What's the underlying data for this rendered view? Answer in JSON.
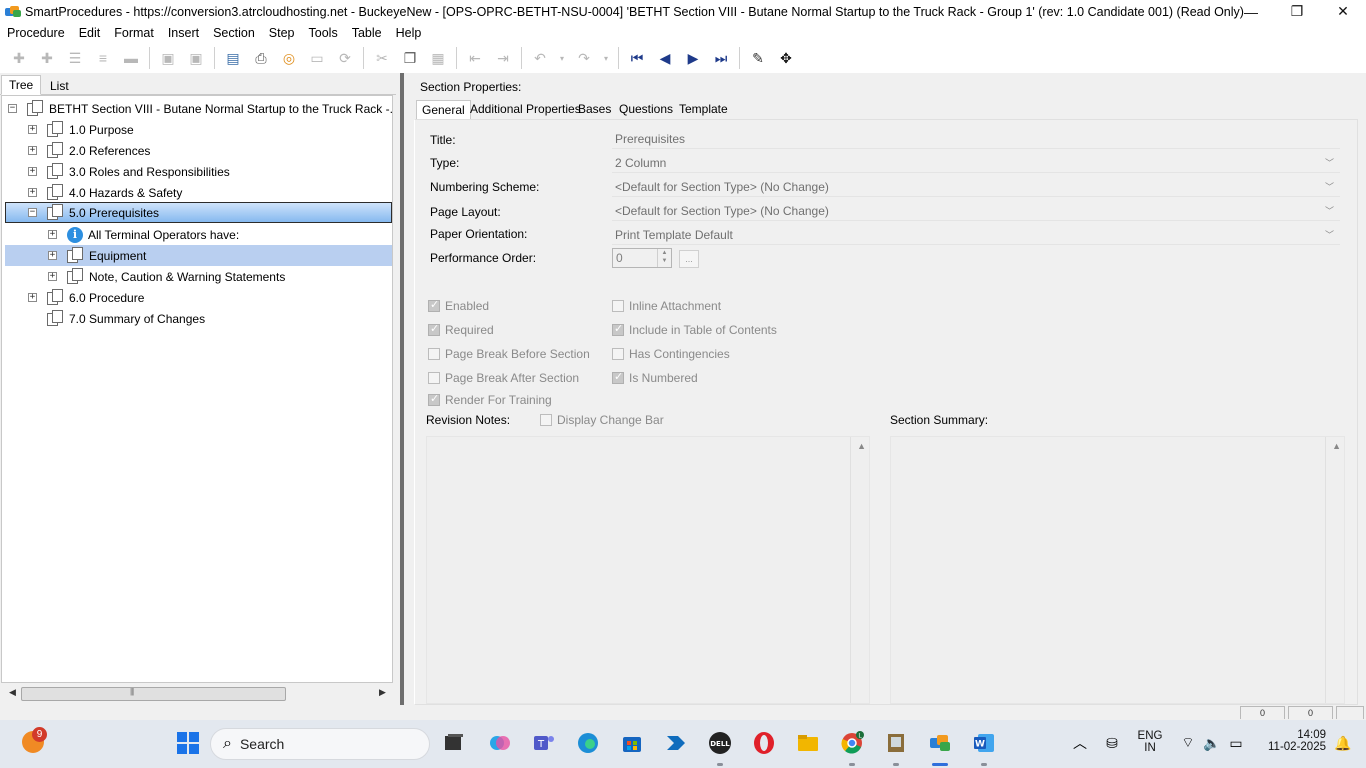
{
  "window": {
    "title": "SmartProcedures - https://conversion3.atrcloudhosting.net - BuckeyeNew - [OPS-OPRC-BETHT-NSU-0004] 'BETHT Section VIII - Butane Normal Startup to the Truck Rack - Group 1' (rev: 1.0 Candidate 001) (Read Only)",
    "controls": {
      "minimize": "—",
      "restore": "❐",
      "close": "✕"
    }
  },
  "menu": [
    "Procedure",
    "Edit",
    "Format",
    "Insert",
    "Section",
    "Step",
    "Tools",
    "Table",
    "Help"
  ],
  "left_tabs": {
    "tree": "Tree",
    "list": "List"
  },
  "tree": {
    "root": "BETHT Section VIII - Butane Normal Startup to the Truck Rack -...",
    "items": [
      {
        "label": "1.0 Purpose",
        "expander": "+"
      },
      {
        "label": "2.0 References",
        "expander": "+"
      },
      {
        "label": "3.0 Roles and Responsibilities",
        "expander": "+"
      },
      {
        "label": "4.0 Hazards & Safety",
        "expander": "+"
      },
      {
        "label": "5.0 Prerequisites",
        "expander": "−"
      },
      {
        "label": "All Terminal Operators have:",
        "expander": "+"
      },
      {
        "label": "Equipment",
        "expander": "+"
      },
      {
        "label": "Note, Caution & Warning Statements",
        "expander": "+"
      },
      {
        "label": "6.0 Procedure",
        "expander": "+"
      },
      {
        "label": "7.0 Summary of Changes",
        "expander": ""
      }
    ],
    "root_expander": "−"
  },
  "section_properties": {
    "heading": "Section Properties:",
    "tabs": [
      "General",
      "Additional Properties",
      "Bases",
      "Questions",
      "Template"
    ],
    "fields": {
      "title_label": "Title:",
      "title_value": "Prerequisites",
      "type_label": "Type:",
      "type_value": "2 Column",
      "numbering_label": "Numbering Scheme:",
      "numbering_value": "<Default for Section Type> (No Change)",
      "layout_label": "Page Layout:",
      "layout_value": "<Default for Section Type> (No Change)",
      "orientation_label": "Paper Orientation:",
      "orientation_value": "Print Template Default",
      "perf_label": "Performance Order:",
      "perf_value": "0",
      "ellipsis": "..."
    },
    "checkboxes": {
      "enabled": {
        "label": "Enabled",
        "checked": true
      },
      "required": {
        "label": "Required",
        "checked": true
      },
      "page_break_before": {
        "label": "Page Break Before Section",
        "checked": false
      },
      "page_break_after": {
        "label": "Page Break After Section",
        "checked": false
      },
      "render_training": {
        "label": "Render For Training",
        "checked": true
      },
      "inline_attachment": {
        "label": "Inline Attachment",
        "checked": false
      },
      "include_toc": {
        "label": "Include in Table of Contents",
        "checked": true
      },
      "has_contingencies": {
        "label": "Has Contingencies",
        "checked": false
      },
      "is_numbered": {
        "label": "Is Numbered",
        "checked": true
      },
      "display_change_bar": {
        "label": "Display Change Bar",
        "checked": false
      }
    },
    "revision_notes_label": "Revision Notes:",
    "section_summary_label": "Section Summary:"
  },
  "status_cells": [
    "0",
    "0"
  ],
  "taskbar": {
    "weather_badge": "9",
    "search_label": "Search",
    "lang_top": "ENG",
    "lang_bottom": "IN",
    "time": "14:09",
    "date": "11-02-2025"
  },
  "colors": {
    "selection_primary": "#86b9ef",
    "selection_secondary": "#b9cff0",
    "nav_icon": "#1e3a8a",
    "taskbar_bg": "#e3e8ef"
  }
}
